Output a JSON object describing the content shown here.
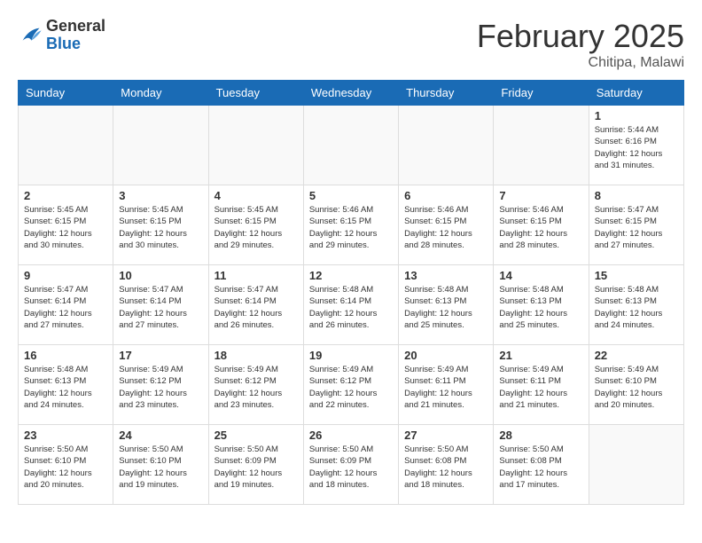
{
  "header": {
    "logo_general": "General",
    "logo_blue": "Blue",
    "month_title": "February 2025",
    "location": "Chitipa, Malawi"
  },
  "days_of_week": [
    "Sunday",
    "Monday",
    "Tuesday",
    "Wednesday",
    "Thursday",
    "Friday",
    "Saturday"
  ],
  "weeks": [
    [
      {
        "day": "",
        "empty": true
      },
      {
        "day": "",
        "empty": true
      },
      {
        "day": "",
        "empty": true
      },
      {
        "day": "",
        "empty": true
      },
      {
        "day": "",
        "empty": true
      },
      {
        "day": "",
        "empty": true
      },
      {
        "day": "1",
        "sunrise": "5:44 AM",
        "sunset": "6:16 PM",
        "daylight": "12 hours and 31 minutes."
      }
    ],
    [
      {
        "day": "2",
        "sunrise": "5:45 AM",
        "sunset": "6:15 PM",
        "daylight": "12 hours and 30 minutes."
      },
      {
        "day": "3",
        "sunrise": "5:45 AM",
        "sunset": "6:15 PM",
        "daylight": "12 hours and 30 minutes."
      },
      {
        "day": "4",
        "sunrise": "5:45 AM",
        "sunset": "6:15 PM",
        "daylight": "12 hours and 29 minutes."
      },
      {
        "day": "5",
        "sunrise": "5:46 AM",
        "sunset": "6:15 PM",
        "daylight": "12 hours and 29 minutes."
      },
      {
        "day": "6",
        "sunrise": "5:46 AM",
        "sunset": "6:15 PM",
        "daylight": "12 hours and 28 minutes."
      },
      {
        "day": "7",
        "sunrise": "5:46 AM",
        "sunset": "6:15 PM",
        "daylight": "12 hours and 28 minutes."
      },
      {
        "day": "8",
        "sunrise": "5:47 AM",
        "sunset": "6:15 PM",
        "daylight": "12 hours and 27 minutes."
      }
    ],
    [
      {
        "day": "9",
        "sunrise": "5:47 AM",
        "sunset": "6:14 PM",
        "daylight": "12 hours and 27 minutes."
      },
      {
        "day": "10",
        "sunrise": "5:47 AM",
        "sunset": "6:14 PM",
        "daylight": "12 hours and 27 minutes."
      },
      {
        "day": "11",
        "sunrise": "5:47 AM",
        "sunset": "6:14 PM",
        "daylight": "12 hours and 26 minutes."
      },
      {
        "day": "12",
        "sunrise": "5:48 AM",
        "sunset": "6:14 PM",
        "daylight": "12 hours and 26 minutes."
      },
      {
        "day": "13",
        "sunrise": "5:48 AM",
        "sunset": "6:13 PM",
        "daylight": "12 hours and 25 minutes."
      },
      {
        "day": "14",
        "sunrise": "5:48 AM",
        "sunset": "6:13 PM",
        "daylight": "12 hours and 25 minutes."
      },
      {
        "day": "15",
        "sunrise": "5:48 AM",
        "sunset": "6:13 PM",
        "daylight": "12 hours and 24 minutes."
      }
    ],
    [
      {
        "day": "16",
        "sunrise": "5:48 AM",
        "sunset": "6:13 PM",
        "daylight": "12 hours and 24 minutes."
      },
      {
        "day": "17",
        "sunrise": "5:49 AM",
        "sunset": "6:12 PM",
        "daylight": "12 hours and 23 minutes."
      },
      {
        "day": "18",
        "sunrise": "5:49 AM",
        "sunset": "6:12 PM",
        "daylight": "12 hours and 23 minutes."
      },
      {
        "day": "19",
        "sunrise": "5:49 AM",
        "sunset": "6:12 PM",
        "daylight": "12 hours and 22 minutes."
      },
      {
        "day": "20",
        "sunrise": "5:49 AM",
        "sunset": "6:11 PM",
        "daylight": "12 hours and 21 minutes."
      },
      {
        "day": "21",
        "sunrise": "5:49 AM",
        "sunset": "6:11 PM",
        "daylight": "12 hours and 21 minutes."
      },
      {
        "day": "22",
        "sunrise": "5:49 AM",
        "sunset": "6:10 PM",
        "daylight": "12 hours and 20 minutes."
      }
    ],
    [
      {
        "day": "23",
        "sunrise": "5:50 AM",
        "sunset": "6:10 PM",
        "daylight": "12 hours and 20 minutes."
      },
      {
        "day": "24",
        "sunrise": "5:50 AM",
        "sunset": "6:10 PM",
        "daylight": "12 hours and 19 minutes."
      },
      {
        "day": "25",
        "sunrise": "5:50 AM",
        "sunset": "6:09 PM",
        "daylight": "12 hours and 19 minutes."
      },
      {
        "day": "26",
        "sunrise": "5:50 AM",
        "sunset": "6:09 PM",
        "daylight": "12 hours and 18 minutes."
      },
      {
        "day": "27",
        "sunrise": "5:50 AM",
        "sunset": "6:08 PM",
        "daylight": "12 hours and 18 minutes."
      },
      {
        "day": "28",
        "sunrise": "5:50 AM",
        "sunset": "6:08 PM",
        "daylight": "12 hours and 17 minutes."
      },
      {
        "day": "",
        "empty": true
      }
    ]
  ]
}
